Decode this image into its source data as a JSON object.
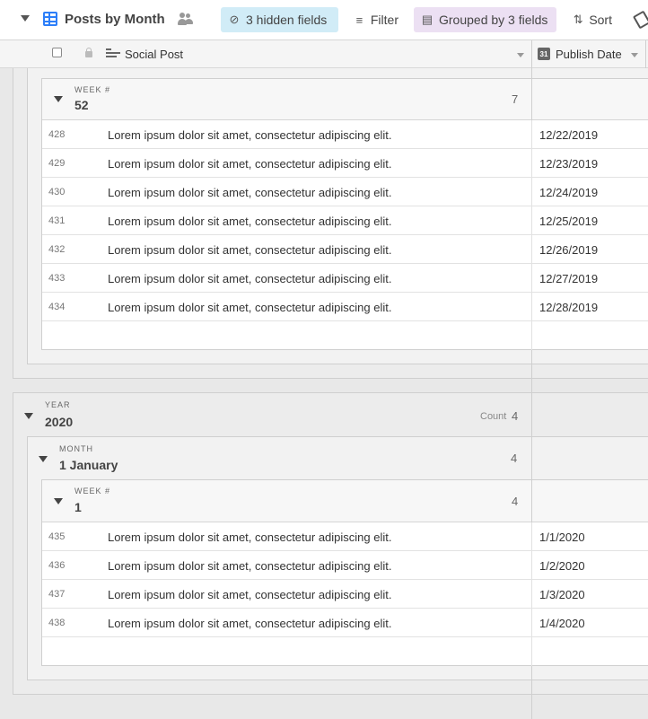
{
  "toolbar": {
    "view_name": "Posts by Month",
    "hidden_fields": "3 hidden fields",
    "filter": "Filter",
    "grouped": "Grouped by 3 fields",
    "sort": "Sort"
  },
  "columns": {
    "primary": "Social Post",
    "date": "Publish Date",
    "date_icon_text": "31"
  },
  "week52": {
    "label": "WEEK #",
    "value": "52",
    "count": "7",
    "rows": [
      {
        "id": "428",
        "post": "Lorem ipsum dolor sit amet, consectetur adipiscing elit.",
        "date": "12/22/2019"
      },
      {
        "id": "429",
        "post": "Lorem ipsum dolor sit amet, consectetur adipiscing elit.",
        "date": "12/23/2019"
      },
      {
        "id": "430",
        "post": "Lorem ipsum dolor sit amet, consectetur adipiscing elit.",
        "date": "12/24/2019"
      },
      {
        "id": "431",
        "post": "Lorem ipsum dolor sit amet, consectetur adipiscing elit.",
        "date": "12/25/2019"
      },
      {
        "id": "432",
        "post": "Lorem ipsum dolor sit amet, consectetur adipiscing elit.",
        "date": "12/26/2019"
      },
      {
        "id": "433",
        "post": "Lorem ipsum dolor sit amet, consectetur adipiscing elit.",
        "date": "12/27/2019"
      },
      {
        "id": "434",
        "post": "Lorem ipsum dolor sit amet, consectetur adipiscing elit.",
        "date": "12/28/2019"
      }
    ]
  },
  "year2020": {
    "label": "YEAR",
    "value": "2020",
    "count_label": "Count",
    "count": "4"
  },
  "month_jan": {
    "label": "MONTH",
    "value": "1 January",
    "count": "4"
  },
  "week1": {
    "label": "WEEK #",
    "value": "1",
    "count": "4",
    "rows": [
      {
        "id": "435",
        "post": "Lorem ipsum dolor sit amet, consectetur adipiscing elit.",
        "date": "1/1/2020"
      },
      {
        "id": "436",
        "post": "Lorem ipsum dolor sit amet, consectetur adipiscing elit.",
        "date": "1/2/2020"
      },
      {
        "id": "437",
        "post": "Lorem ipsum dolor sit amet, consectetur adipiscing elit.",
        "date": "1/3/2020"
      },
      {
        "id": "438",
        "post": "Lorem ipsum dolor sit amet, consectetur adipiscing elit.",
        "date": "1/4/2020"
      }
    ]
  }
}
